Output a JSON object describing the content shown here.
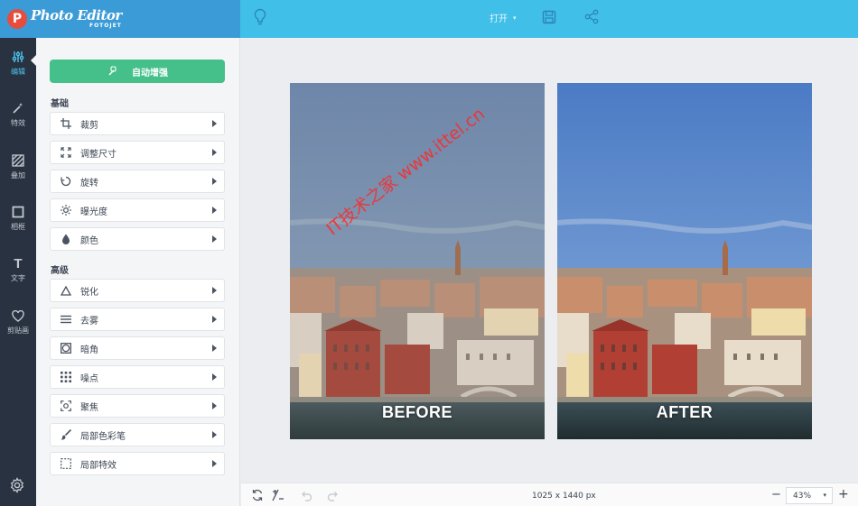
{
  "app": {
    "logo_letter": "P",
    "name": "Photo Editor",
    "sub": "FOTOJET"
  },
  "toolbar": {
    "open_label": "打开",
    "caret": "▾"
  },
  "rail": [
    {
      "label": "编辑",
      "icon": "sliders-icon"
    },
    {
      "label": "特效",
      "icon": "magic-wand-icon"
    },
    {
      "label": "叠加",
      "icon": "overlay-icon"
    },
    {
      "label": "相框",
      "icon": "frame-icon"
    },
    {
      "label": "文字",
      "icon": "text-icon"
    },
    {
      "label": "剪贴画",
      "icon": "heart-icon"
    }
  ],
  "panel": {
    "auto_enhance": "自动增强",
    "basic_title": "基础",
    "basic_tools": [
      "裁剪",
      "调整尺寸",
      "旋转",
      "曝光度",
      "颜色"
    ],
    "advanced_title": "高级",
    "advanced_tools": [
      "锐化",
      "去雾",
      "暗角",
      "噪点",
      "聚焦",
      "局部色彩笔",
      "局部特效"
    ]
  },
  "canvas": {
    "before_label": "BEFORE",
    "after_label": "AFTER",
    "watermark": "IT技术之家 www.ittel.cn"
  },
  "bottombar": {
    "dimensions": "1025 x 1440 px",
    "zoom": "43%",
    "minus": "−",
    "plus": "+"
  },
  "colors": {
    "header_left": "#3b9bd6",
    "header_right": "#40bfe8",
    "rail": "#293240",
    "accent_green": "#45c08a",
    "active_blue": "#4fc3ef"
  }
}
